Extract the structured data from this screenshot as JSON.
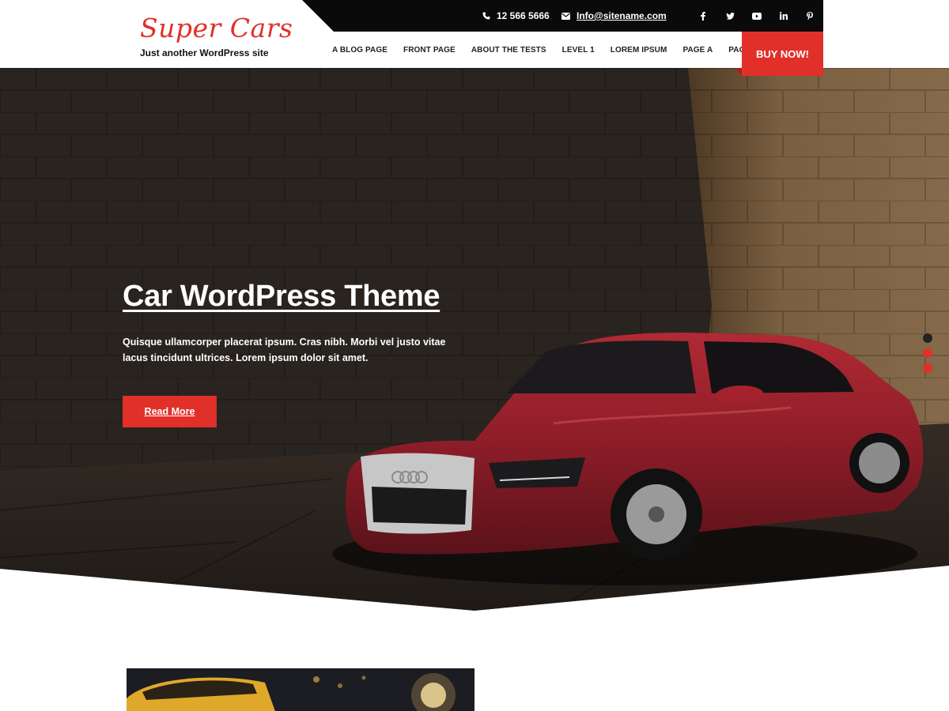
{
  "site": {
    "title": "Super Cars",
    "tagline": "Just another WordPress site"
  },
  "topbar": {
    "phone": "12 566 5666",
    "email": "Info@sitename.com",
    "social": [
      "facebook-icon",
      "twitter-icon",
      "youtube-icon",
      "linkedin-icon",
      "pinterest-icon"
    ]
  },
  "nav": {
    "items": [
      "A BLOG PAGE",
      "FRONT PAGE",
      "ABOUT THE TESTS",
      "LEVEL 1",
      "LOREM IPSUM",
      "PAGE A",
      "PAGE B"
    ],
    "buy_label": "BUY NOW!"
  },
  "hero": {
    "title": "Car WordPress Theme",
    "description": "Quisque ullamcorper placerat ipsum. Cras nibh. Morbi vel justo vitae lacus tincidunt ultrices. Lorem ipsum dolor sit amet.",
    "button_label": "Read More",
    "slides": 3,
    "active_slide": 1
  },
  "colors": {
    "accent": "#e1302a",
    "topbar": "#0a0a0a",
    "dot_active": "#222222"
  }
}
